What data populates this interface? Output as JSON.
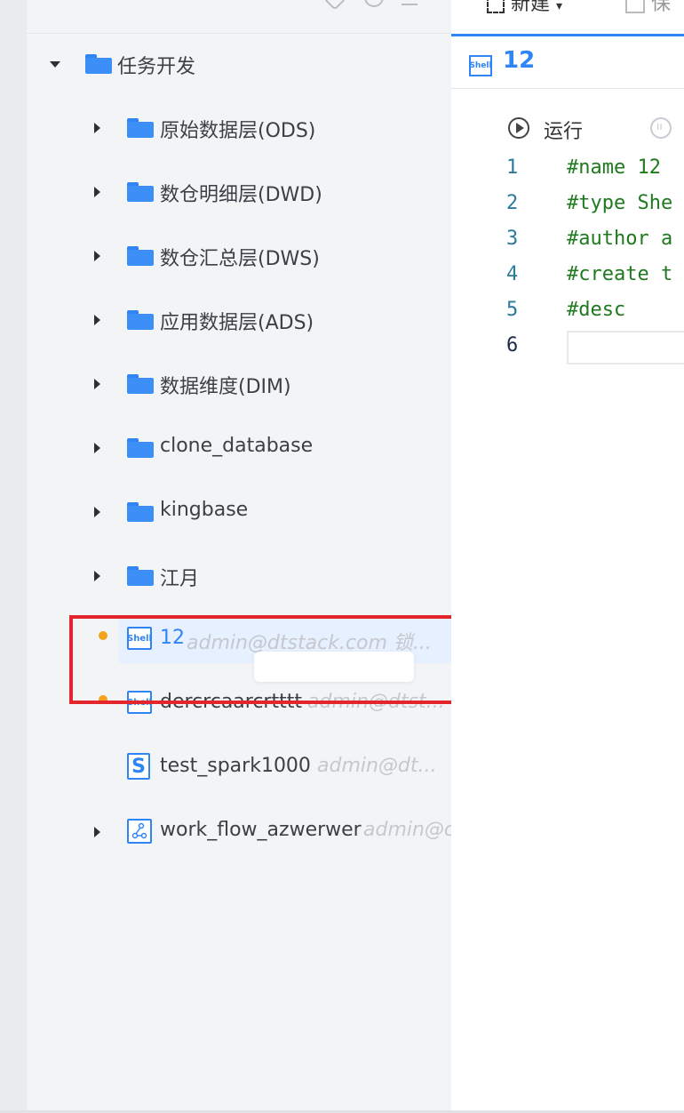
{
  "sidebar": {
    "root": {
      "label": "任务开发"
    },
    "folders": [
      {
        "label": "原始数据层(ODS)"
      },
      {
        "label": "数仓明细层(DWD)"
      },
      {
        "label": "数仓汇总层(DWS)"
      },
      {
        "label": "应用数据层(ADS)"
      },
      {
        "label": "数据维度(DIM)"
      },
      {
        "label": "clone_database"
      },
      {
        "label": "kingbase"
      },
      {
        "label": "江月"
      }
    ],
    "tasks": [
      {
        "name": "12",
        "meta": "admin@dtstack.com 锁...",
        "icon_text": "Shell",
        "status": "modified"
      },
      {
        "name": "dercrcaarcrtttt",
        "meta": "admin@dtst...",
        "icon_text": "Shell",
        "status": "modified"
      },
      {
        "name": "test_spark1000",
        "meta": "admin@dt...",
        "icon_text": "S"
      },
      {
        "name": "work_flow_azwerwer",
        "meta": "admin@c",
        "icon_text": ""
      }
    ]
  },
  "toolbar": {
    "new_label": "新建",
    "save_label": "保"
  },
  "editor": {
    "tab_title": "12",
    "tab_icon_text": "Shell",
    "run_label": "运行",
    "lines": [
      {
        "n": "1",
        "text": "#name 12"
      },
      {
        "n": "2",
        "text": "#type She"
      },
      {
        "n": "3",
        "text": "#author a"
      },
      {
        "n": "4",
        "text": "#create t"
      },
      {
        "n": "5",
        "text": "#desc"
      },
      {
        "n": "6",
        "text": ""
      }
    ]
  },
  "colors": {
    "accent": "#2f85f6",
    "highlight": "#e4262c",
    "modified_dot": "#f4a21b"
  }
}
